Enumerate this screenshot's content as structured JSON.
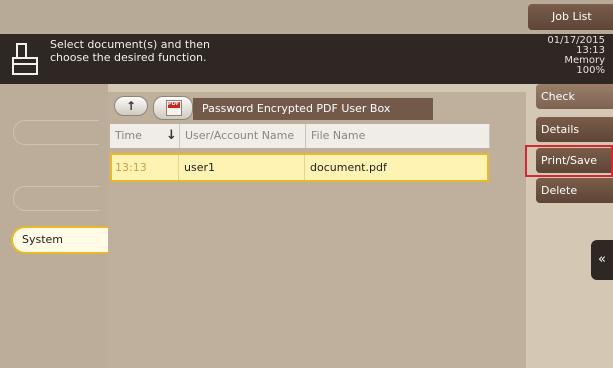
{
  "header": {
    "job_list_label": "Job List",
    "message_line1": "Select document(s) and then",
    "message_line2": "choose the desired function.",
    "date": "01/17/2015",
    "time": "13:13",
    "memory_label": "Memory",
    "memory_value": "100%"
  },
  "left_panel": {
    "system_tab_label": "System"
  },
  "box": {
    "name": "Password Encrypted PDF User Box"
  },
  "table": {
    "columns": [
      "Time",
      "User/Account Name",
      "File Name"
    ],
    "rows": [
      {
        "time": "13:13",
        "user": "user1",
        "file": "document.pdf"
      }
    ]
  },
  "right_menu": {
    "check_setting": "Check Setting",
    "details": "Details",
    "print_save": "Print/Save",
    "delete": "Delete"
  },
  "colors": {
    "accent_yellow": "#e8b928",
    "highlight_red": "#d6282f",
    "button_brown": "#6b4f3f"
  }
}
